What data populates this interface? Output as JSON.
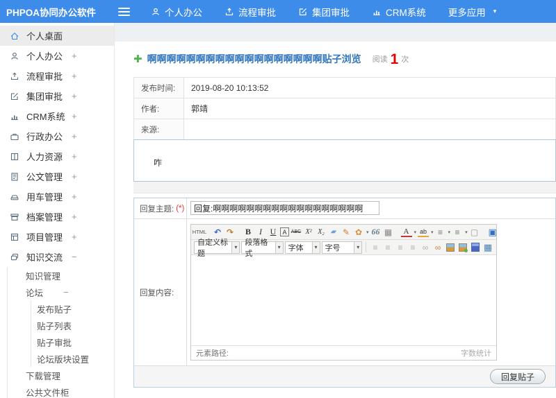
{
  "colors": {
    "header_blue": "#3e8ce9",
    "title_blue": "#3177bd",
    "count_red": "#e60000",
    "plus_green": "#4db848"
  },
  "header": {
    "brand": "PHPOA协同办公软件",
    "nav": [
      {
        "label": "个人办公"
      },
      {
        "label": "流程审批"
      },
      {
        "label": "集团审批"
      },
      {
        "label": "CRM系统"
      },
      {
        "label": "更多应用"
      }
    ],
    "caret": "▾"
  },
  "sidebar": {
    "items": [
      {
        "label": "个人桌面",
        "toggle": ""
      },
      {
        "label": "个人办公",
        "toggle": "+"
      },
      {
        "label": "流程审批",
        "toggle": "+"
      },
      {
        "label": "集团审批",
        "toggle": "+"
      },
      {
        "label": "CRM系统",
        "toggle": "+"
      },
      {
        "label": "行政办公",
        "toggle": "+"
      },
      {
        "label": "人力资源",
        "toggle": "+"
      },
      {
        "label": "公文管理",
        "toggle": "+"
      },
      {
        "label": "用车管理",
        "toggle": "+"
      },
      {
        "label": "档案管理",
        "toggle": "+"
      },
      {
        "label": "项目管理",
        "toggle": "+"
      },
      {
        "label": "知识交流",
        "toggle": "−"
      }
    ],
    "sub1": [
      {
        "label": "知识管理",
        "toggle": ""
      },
      {
        "label": "论坛",
        "toggle": "−"
      },
      {
        "label": "下载管理",
        "toggle": ""
      },
      {
        "label": "公共文件柜",
        "toggle": ""
      }
    ],
    "sub2": [
      {
        "label": "发布贴子"
      },
      {
        "label": "贴子列表"
      },
      {
        "label": "贴子审批"
      },
      {
        "label": "论坛版块设置"
      }
    ]
  },
  "post": {
    "add_icon_glyph": "✚",
    "title": "啊啊啊啊啊啊啊啊啊啊啊啊啊啊啊啊啊啊贴子浏览",
    "read_label": "阅读",
    "read_count": "1",
    "read_unit": "次",
    "fields": [
      {
        "label": "发布时间:",
        "value": "2019-08-20 10:13:52"
      },
      {
        "label": "作者:",
        "value": "郭靖"
      },
      {
        "label": "来源:",
        "value": ""
      }
    ],
    "content": "咋"
  },
  "reply": {
    "subject_label": "回复主题:",
    "required_mark": "(*)",
    "subject_value": "回复:啊啊啊啊啊啊啊啊啊啊啊啊啊啊啊啊啊啊",
    "content_label": "回复内容:",
    "submit_label": "回复贴子"
  },
  "editor": {
    "caret": "▾",
    "toolbar_row1": [
      {
        "name": "html-source-button",
        "glyph": "HTML"
      },
      {
        "name": "undo-icon",
        "glyph": "↶"
      },
      {
        "name": "redo-icon",
        "glyph": "↷"
      },
      {
        "name": "bold-icon",
        "glyph": "B"
      },
      {
        "name": "italic-icon",
        "glyph": "I"
      },
      {
        "name": "underline-icon",
        "glyph": "U"
      },
      {
        "name": "font-name-icon",
        "glyph": "A"
      },
      {
        "name": "strikethrough-icon",
        "glyph": "ABC"
      },
      {
        "name": "superscript-icon",
        "glyph": "X²"
      },
      {
        "name": "subscript-icon",
        "glyph": "X₂"
      },
      {
        "name": "remove-format-icon",
        "glyph": "▰"
      },
      {
        "name": "format-brush-icon",
        "glyph": "✎"
      },
      {
        "name": "fill-color-icon",
        "glyph": "✿"
      },
      {
        "name": "blockquote-icon",
        "glyph": "66"
      },
      {
        "name": "insert-date-icon",
        "glyph": "▦"
      },
      {
        "name": "font-color-icon",
        "glyph": "A"
      },
      {
        "name": "highlight-color-icon",
        "glyph": "ab"
      },
      {
        "name": "ordered-list-icon",
        "glyph": "≡"
      },
      {
        "name": "unordered-list-icon",
        "glyph": "≡"
      },
      {
        "name": "new-page-icon",
        "glyph": "▢"
      },
      {
        "name": "fullscreen-icon",
        "glyph": "▣"
      }
    ],
    "dropdowns": [
      {
        "label": "自定义标题"
      },
      {
        "label": "段落格式"
      },
      {
        "label": "字体"
      },
      {
        "label": "字号"
      }
    ],
    "toolbar_row2_icons": [
      {
        "name": "align-left-icon",
        "glyph": "≡"
      },
      {
        "name": "align-center-icon",
        "glyph": "≡"
      },
      {
        "name": "align-right-icon",
        "glyph": "≡"
      },
      {
        "name": "align-justify-icon",
        "glyph": "≡"
      },
      {
        "name": "link-icon",
        "glyph": "∞"
      },
      {
        "name": "unlink-icon",
        "glyph": "∞"
      },
      {
        "name": "image-icon",
        "glyph": ""
      },
      {
        "name": "insert-image-icon",
        "glyph": ""
      },
      {
        "name": "media-icon",
        "glyph": ""
      },
      {
        "name": "table-icon",
        "glyph": "▦"
      }
    ],
    "status_left": "元素路径:",
    "status_right": "字数统计"
  }
}
